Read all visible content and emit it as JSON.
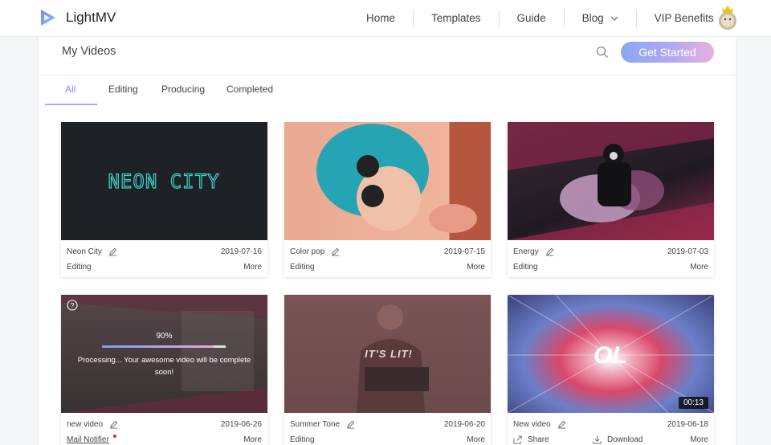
{
  "app": {
    "name": "LightMV"
  },
  "nav": {
    "home": "Home",
    "templates": "Templates",
    "guide": "Guide",
    "blog": "Blog",
    "vip": "VIP Benefits"
  },
  "header": {
    "title": "My Videos",
    "get_started": "Get Started"
  },
  "tabs": [
    "All",
    "Editing",
    "Producing",
    "Completed"
  ],
  "colors": {
    "accent": "#7b93e6",
    "progress_start": "#7f9df0",
    "progress_end": "#e4a9d9"
  },
  "videos": [
    {
      "name": "Neon City",
      "date": "2019-07-16",
      "status": "Editing",
      "more": "More",
      "thumb_text": "NEON CITY"
    },
    {
      "name": "Color pop",
      "date": "2019-07-15",
      "status": "Editing",
      "more": "More"
    },
    {
      "name": "Energy",
      "date": "2019-07-03",
      "status": "Editing",
      "more": "More"
    },
    {
      "name": "new video",
      "date": "2019-06-26",
      "status_link": "Mail Notifier",
      "more": "More",
      "progress_percent": 90,
      "progress_label": "90%",
      "processing_text": "Processing... Your awesome video will be complete soon!"
    },
    {
      "name": "Summer Tone",
      "date": "2019-06-20",
      "status": "Editing",
      "more": "More",
      "thumb_text": "IT'S LIT!"
    },
    {
      "name": "New video",
      "date": "2019-06-18",
      "share": "Share",
      "download": "Download",
      "more": "More",
      "duration": "00:13",
      "thumb_text": "OL"
    }
  ]
}
